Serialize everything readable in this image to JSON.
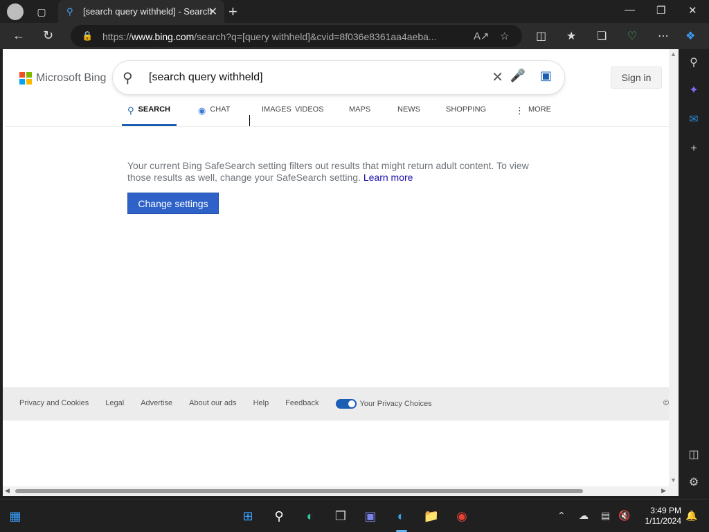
{
  "browser": {
    "tab_title": "[search query withheld] - Search",
    "tab_favicon": "bing-search-icon",
    "url_host": "www.bing.com",
    "url_prefix": "https://",
    "url_rest": "/search?q=[query withheld]&cvid=8f036e8361aa4aeba..."
  },
  "bing": {
    "logo_text": "Microsoft Bing",
    "search_value": "[search query withheld]",
    "sign_in": "Sign in",
    "tabs": [
      {
        "label": "SEARCH",
        "icon": "search-icon",
        "active": true
      },
      {
        "label": "CHAT",
        "icon": "copilot-chat-icon",
        "active": false
      },
      {
        "label": "IMAGES",
        "active": false
      },
      {
        "label": "VIDEOS",
        "active": false
      },
      {
        "label": "MAPS",
        "active": false
      },
      {
        "label": "NEWS",
        "active": false
      },
      {
        "label": "SHOPPING",
        "active": false
      },
      {
        "label": "MORE",
        "icon": "more-vertical-icon",
        "active": false
      }
    ],
    "notice_text": "Your current Bing SafeSearch setting filters out results that might return adult content. To view those results as well, change your SafeSearch setting. ",
    "learn_more": "Learn more",
    "change_settings": "Change settings",
    "footer_links": [
      "Privacy and Cookies",
      "Legal",
      "Advertise",
      "About our ads",
      "Help",
      "Feedback"
    ],
    "privacy_choices": "Your Privacy Choices",
    "footer_copyright": "©"
  },
  "taskbar": {
    "time": "3:49 PM",
    "date": "1/11/2024"
  },
  "colors": {
    "accent": "#1a5fb4",
    "button": "#2e62c8",
    "link": "#1a0dab"
  }
}
